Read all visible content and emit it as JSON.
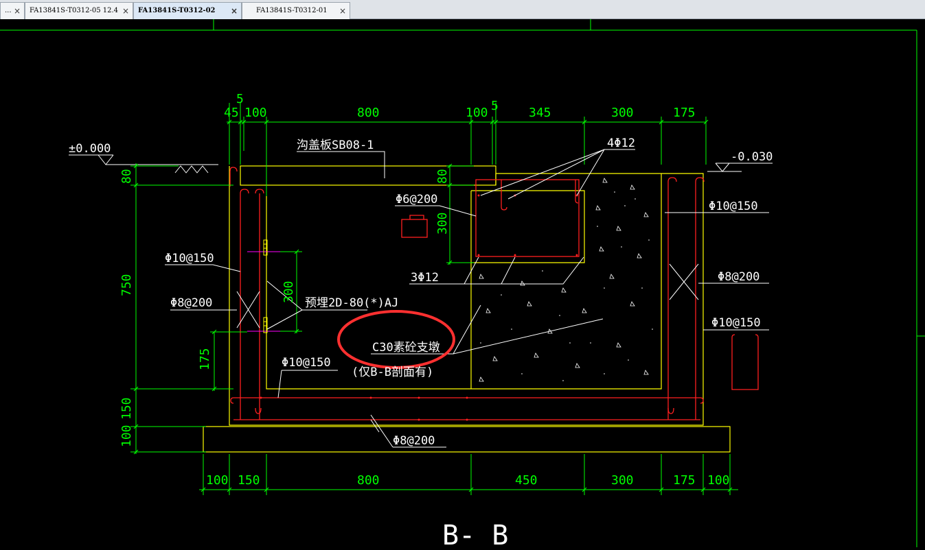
{
  "tabs": [
    {
      "label": "...",
      "active": false
    },
    {
      "label": "FA13841S-T0312-05 12.4",
      "active": false
    },
    {
      "label": "FA13841S-T0312-02",
      "active": true
    },
    {
      "label": "FA13841S-T0312-01",
      "active": false
    }
  ],
  "close_glyph": "×",
  "colors": {
    "background": "#000000",
    "dimension": "#00ff00",
    "outline": "#ffff00",
    "rebar": "#ff2020",
    "annotation": "#ffffff",
    "highlight": "#ff3030"
  },
  "drawing": {
    "title": "B- B",
    "top_dims": [
      "45",
      "5",
      "100",
      "800",
      "100",
      "5",
      "345",
      "300",
      "175"
    ],
    "bottom_dims": [
      "100",
      "150",
      "800",
      "450",
      "300",
      "175",
      "100"
    ],
    "left_dims": [
      "80",
      "750",
      "175",
      "150",
      "100"
    ],
    "inner_dims": [
      "80",
      "300",
      "300"
    ],
    "level_left": "±0.000",
    "level_right": "-0.030",
    "labels": {
      "cover_slab": "沟盖板SB08-1",
      "rebar_4phi12": "4Φ12",
      "rebar_phi6_200": "Φ6@200",
      "rebar_phi10_150_right_top": "Φ10@150",
      "rebar_phi10_150_left": "Φ10@150",
      "rebar_phi8_200_left": "Φ8@200",
      "rebar_phi8_200_right": "Φ8@200",
      "rebar_3phi12": "3Φ12",
      "embedded": "预埋2D-80(*)AJ",
      "c30": "C30素砼支墩",
      "c30_note": "(仅B-B剖面有)",
      "rebar_phi10_150_right_bottom": "Φ10@150",
      "rebar_phi10_150_bottom": "Φ10@150",
      "rebar_phi8_200_bottom": "Φ8@200"
    }
  }
}
